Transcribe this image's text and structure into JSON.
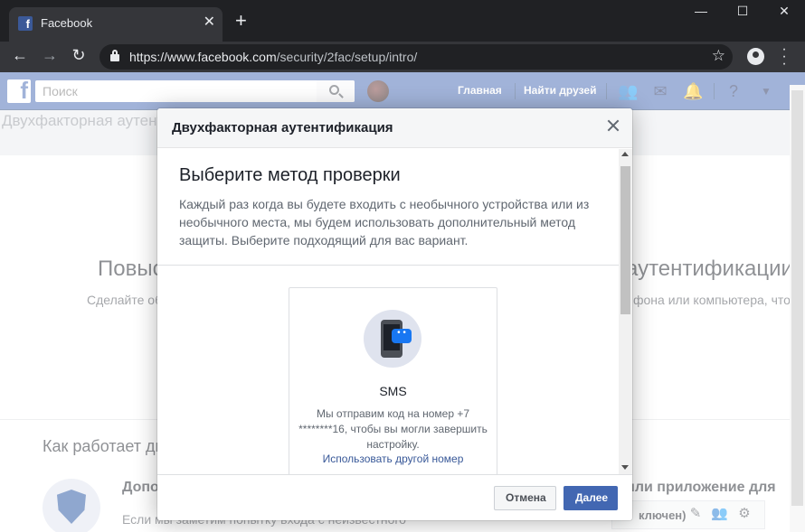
{
  "browser": {
    "tab_title": "Facebook",
    "tab_close": "✕",
    "new_tab": "+",
    "url_host": "https://www.facebook.com",
    "url_path": "/security/2fac/setup/intro/",
    "window_controls": [
      "—",
      "☐",
      "✕"
    ]
  },
  "fb": {
    "logo": "f",
    "search_placeholder": "Поиск",
    "nav_home": "Главная",
    "nav_find_friends": "Найти друзей"
  },
  "background": {
    "page_title": "Двухфакторная аутентификация",
    "heading_left": "Повыс",
    "heading_right": "аутентификации",
    "text_left": "Сделайте об",
    "text_right": "фона или компьютера, чтоб",
    "how_title": "Как работает ди",
    "method_title": "Допо",
    "method_text": "Если мы заметим попытку входа с неизвестного",
    "app_title": "или приложение для",
    "chat_status": "ключен)"
  },
  "dialog": {
    "title": "Двухфакторная аутентификация",
    "heading": "Выберите метод проверки",
    "description": "Каждый раз когда вы будете входить с необычного устройства или из необычного места, мы будем использовать дополнительный метод защиты. Выберите подходящий для вас вариант.",
    "sms_label": "SMS",
    "sms_desc": "Мы отправим код на номер +7 ********16, чтобы вы могли завершить настройку.",
    "sms_link": "Использовать другой номер",
    "cancel_label": "Отмена",
    "next_label": "Далее"
  },
  "colors": {
    "fb_blue": "#4267b2",
    "link": "#385898",
    "chrome_dark": "#202124"
  }
}
